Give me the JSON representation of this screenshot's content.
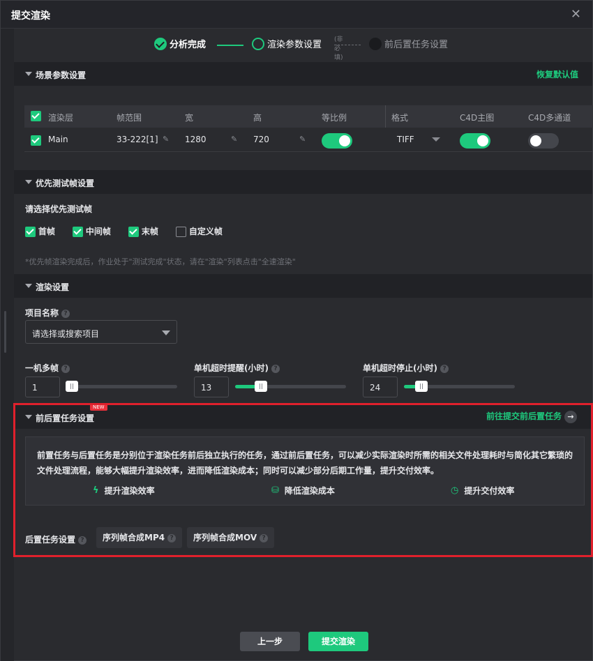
{
  "window": {
    "title": "提交渲染",
    "close_label": "✕"
  },
  "steps": [
    {
      "label": "分析完成",
      "state": "done"
    },
    {
      "label": "渲染参数设置",
      "state": "current"
    },
    {
      "label": "前后置任务设置",
      "state": "todo",
      "tag": "(非必填)"
    }
  ],
  "scene": {
    "title": "场景参数设置",
    "reset_label": "恢复默认值",
    "columns": [
      "渲染层",
      "帧范围",
      "宽",
      "高",
      "等比例",
      "格式",
      "C4D主图",
      "C4D多通道"
    ],
    "rows": [
      {
        "layer": "Main",
        "frame_range": "33-222[1]",
        "width": "1280",
        "height": "720",
        "keep_ratio": true,
        "format": "TIFF",
        "c4d_main": true,
        "c4d_multipass": false
      }
    ]
  },
  "priority": {
    "title": "优先测试帧设置",
    "prompt": "请选择优先测试帧",
    "options": [
      {
        "label": "首帧",
        "checked": true
      },
      {
        "label": "中间帧",
        "checked": true
      },
      {
        "label": "末帧",
        "checked": true
      },
      {
        "label": "自定义帧",
        "checked": false
      }
    ],
    "note": "*优先帧渲染完成后，作业处于\"测试完成\"状态，请在\"渲染\"列表点击\"全速渲染\""
  },
  "render": {
    "title": "渲染设置",
    "project_label": "项目名称",
    "project_placeholder": "请选择或搜索项目",
    "multi_frame_label": "一机多帧",
    "multi_frame_value": "1",
    "multi_frame_level": 0.05,
    "timeout_warn_label": "单机超时提醒(小时)",
    "timeout_warn_value": "13",
    "timeout_warn_level": 0.23,
    "timeout_stop_label": "单机超时停止(小时)",
    "timeout_stop_value": "24",
    "timeout_stop_level": 0.16
  },
  "prepost": {
    "title": "前后置任务设置",
    "badge": "NEW",
    "goto_label": "前往提交前后置任务",
    "description": "前置任务与后置任务是分别位于渲染任务前后独立执行的任务，通过前后置任务，可以减少实际渲染时所需的相关文件处理耗时与简化其它繁琐的文件处理流程，能够大幅提升渲染效率，进而降低渲染成本；同时可以减少部分后期工作量，提升交付效率。",
    "features": [
      {
        "icon": "lightning-icon",
        "label": "提升渲染效率"
      },
      {
        "icon": "coins-icon",
        "label": "降低渲染成本"
      },
      {
        "icon": "clock-icon",
        "label": "提升交付效率"
      }
    ],
    "post_label": "后置任务设置",
    "post_options": [
      "序列帧合成MP4",
      "序列帧合成MOV"
    ]
  },
  "footer": {
    "prev_label": "上一步",
    "submit_label": "提交渲染"
  },
  "colors": {
    "accent": "#1ec97d",
    "highlight": "#e0202c",
    "background": "#2a2b2f"
  }
}
